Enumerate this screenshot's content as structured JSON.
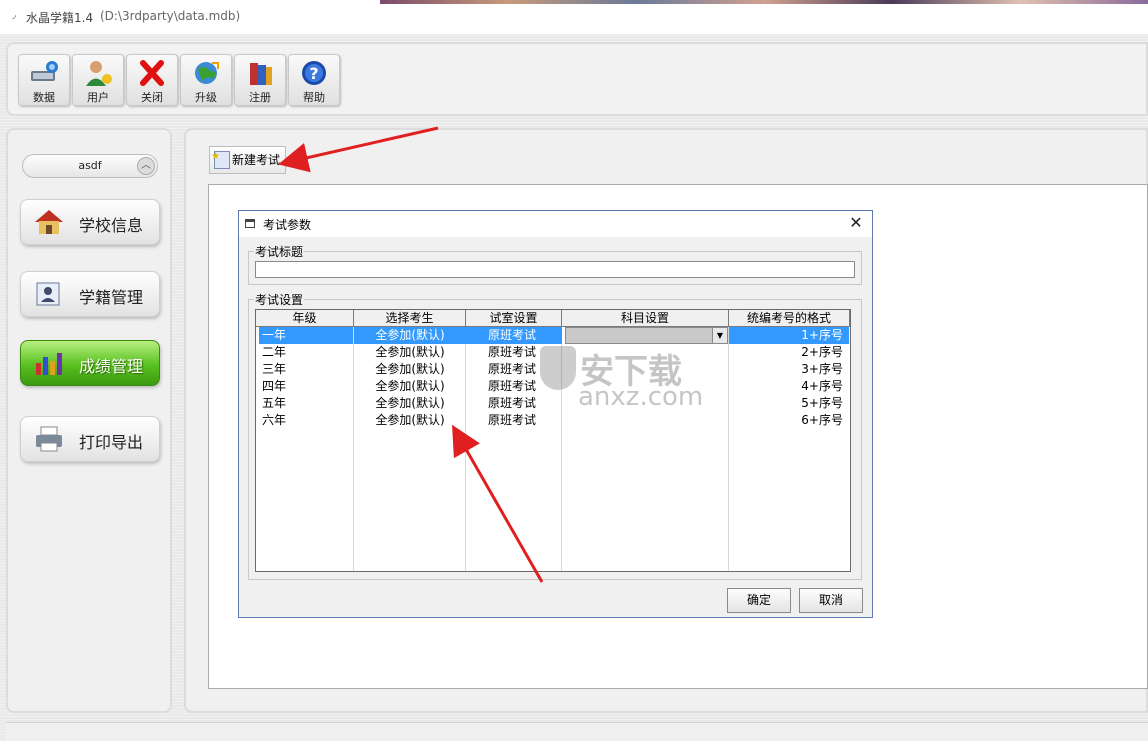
{
  "window": {
    "title": "水晶学籍1.4",
    "path": "(D:\\3rdparty\\data.mdb)"
  },
  "toolbar": {
    "buttons": [
      {
        "label": "数据",
        "icon": "database-icon"
      },
      {
        "label": "用户",
        "icon": "user-icon"
      },
      {
        "label": "关闭",
        "icon": "close-icon"
      },
      {
        "label": "升级",
        "icon": "upgrade-icon"
      },
      {
        "label": "注册",
        "icon": "register-icon"
      },
      {
        "label": "帮助",
        "icon": "help-icon"
      }
    ]
  },
  "sidebar": {
    "user_select": "asdf",
    "items": [
      {
        "label": "学校信息",
        "icon": "school-house-icon",
        "active": false
      },
      {
        "label": "学籍管理",
        "icon": "student-card-icon",
        "active": false
      },
      {
        "label": "成绩管理",
        "icon": "score-chart-icon",
        "active": true
      },
      {
        "label": "打印导出",
        "icon": "printer-icon",
        "active": false
      }
    ]
  },
  "main": {
    "new_exam_label": "新建考试"
  },
  "dialog": {
    "title": "考试参数",
    "close_glyph": "✕",
    "exam_title_group": "考试标题",
    "exam_title_value": "",
    "exam_settings_group": "考试设置",
    "columns": [
      "年级",
      "选择考生",
      "试室设置",
      "科目设置",
      "统编考号的格式"
    ],
    "rows": [
      {
        "grade": "一年",
        "students": "全参加(默认)",
        "room": "原班考试",
        "subject": "",
        "format": "1+序号"
      },
      {
        "grade": "二年",
        "students": "全参加(默认)",
        "room": "原班考试",
        "subject": "",
        "format": "2+序号"
      },
      {
        "grade": "三年",
        "students": "全参加(默认)",
        "room": "原班考试",
        "subject": "",
        "format": "3+序号"
      },
      {
        "grade": "四年",
        "students": "全参加(默认)",
        "room": "原班考试",
        "subject": "",
        "format": "4+序号"
      },
      {
        "grade": "五年",
        "students": "全参加(默认)",
        "room": "原班考试",
        "subject": "",
        "format": "5+序号"
      },
      {
        "grade": "六年",
        "students": "全参加(默认)",
        "room": "原班考试",
        "subject": "",
        "format": "6+序号"
      }
    ],
    "ok_label": "确定",
    "cancel_label": "取消"
  },
  "watermark": {
    "cn": "安下载",
    "en": "anxz.com"
  },
  "colors": {
    "selection": "#3399ff",
    "active_nav": "#58c020",
    "arrow": "#e02020"
  }
}
